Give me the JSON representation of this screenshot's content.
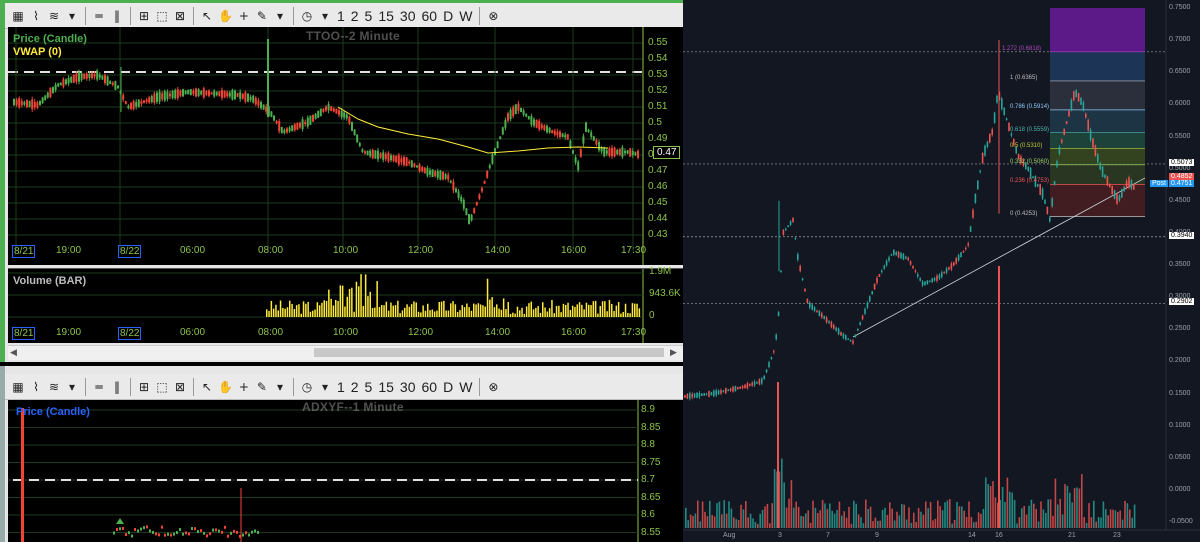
{
  "toolbar": {
    "intervals": [
      "1",
      "2",
      "5",
      "15",
      "30",
      "60",
      "D",
      "W"
    ]
  },
  "chart1": {
    "title": "TTOO--2 Minute",
    "indicators": [
      "Price (Candle)",
      "VWAP (0)"
    ],
    "indicator_colors": [
      "#4caf50",
      "#ffeb3b"
    ],
    "y_ticks": [
      "0.55",
      "0.54",
      "0.53",
      "0.52",
      "0.51",
      "0.5",
      "0.49",
      "0.48",
      "0.47",
      "0.46",
      "0.45",
      "0.44",
      "0.43"
    ],
    "last_price": "0.47",
    "x_labels": [
      "8/21",
      "19:00",
      "8/22",
      "06:00",
      "08:00",
      "10:00",
      "12:00",
      "14:00",
      "16:00",
      "17:30"
    ],
    "volume": {
      "title": "Volume (BAR)",
      "y_ticks": [
        "1.9M",
        "943.6K",
        "0"
      ],
      "x_labels": [
        "8/21",
        "19:00",
        "8/22",
        "06:00",
        "08:00",
        "10:00",
        "12:00",
        "14:00",
        "16:00",
        "17:30"
      ]
    }
  },
  "chart2": {
    "title": "ADXYF--1 Minute",
    "indicators": [
      "Price (Candle)"
    ],
    "y_ticks": [
      "8.9",
      "8.85",
      "8.8",
      "8.75",
      "8.7",
      "8.65",
      "8.6",
      "8.55"
    ]
  },
  "tv": {
    "y_ticks": [
      "0.7500",
      "0.7000",
      "0.6500",
      "0.6000",
      "0.5500",
      "0.5000",
      "0.4500",
      "0.4000",
      "0.3500",
      "0.3000",
      "0.2500",
      "0.2000",
      "0.1500",
      "0.1000",
      "0.0500",
      "0.0000",
      "-0.0500"
    ],
    "x_labels": [
      "Aug",
      "3",
      "7",
      "9",
      "14",
      "16",
      "21",
      "23"
    ],
    "price_tags": [
      {
        "text": "0.5073",
        "bg": "#ffffff",
        "fg": "#000000"
      },
      {
        "text": "0.4852",
        "bg": "#ef5350",
        "fg": "#ffffff"
      },
      {
        "text": "0.4751",
        "bg": "#2196f3",
        "fg": "#ffffff"
      },
      {
        "text": "0.3940",
        "bg": "#ffffff",
        "fg": "#000000"
      },
      {
        "text": "0.2902",
        "bg": "#ffffff",
        "fg": "#000000"
      }
    ],
    "post_label": "Post",
    "fib_levels": [
      {
        "label": "1.272 (0.6818)",
        "color": "#ab47bc"
      },
      {
        "label": "1 (0.6365)",
        "color": "#bdbdbd"
      },
      {
        "label": "0.786 (0.5914)",
        "color": "#90caf9"
      },
      {
        "label": "0.618 (0.5559)",
        "color": "#4db6ac"
      },
      {
        "label": "0.5 (0.5310)",
        "color": "#c0ca33"
      },
      {
        "label": "0.382 (0.5060)",
        "color": "#9ccc65"
      },
      {
        "label": "0.236 (0.4753)",
        "color": "#ef5350"
      },
      {
        "label": "0 (0.4253)",
        "color": "#bdbdbd"
      }
    ]
  }
}
